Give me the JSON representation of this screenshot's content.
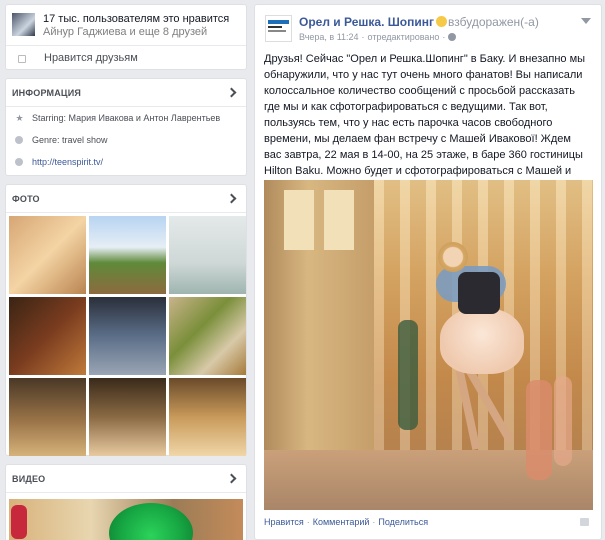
{
  "likes": {
    "count_text": "17 тыс. пользователям это нравится",
    "names_text": "Айнур Гаджиева и еще 8 друзей",
    "friends_button": "Нравится друзьям"
  },
  "info": {
    "title": "ИНФОРМАЦИЯ",
    "starring": "Starring: Мария Ивакова и Антон Лаврентьев",
    "genre": "Genre: travel show",
    "link": "http://teenspirit.tv/"
  },
  "photos": {
    "title": "ФОТО",
    "items": [
      {
        "bg": "linear-gradient(135deg,#d7a675,#f4d4a4 50%,#b98450)"
      },
      {
        "bg": "linear-gradient(180deg,#b7d4f2 0%,#e6eef5 40%,#5f8a3a 60%,#8c6b3e 100%)"
      },
      {
        "bg": "linear-gradient(180deg,#e4e9ea,#cfd8d6 60%,#9fb5b0)"
      },
      {
        "bg": "linear-gradient(135deg,#3a2414,#7a3c1f 50%,#c07a3a)"
      },
      {
        "bg": "linear-gradient(180deg,#2a2f3a,#5b6e88 50%,#9aa5b5)"
      },
      {
        "bg": "linear-gradient(135deg,#c9b38a,#7a8f3a 40%,#d8c9a8 70%,#a57a3a)"
      },
      {
        "bg": "linear-gradient(180deg,#4a3826,#9a7448 55%,#d6b27a)"
      },
      {
        "bg": "linear-gradient(180deg,#3a2a1a,#8a6a44 50%,#e8caa0)"
      },
      {
        "bg": "linear-gradient(180deg,#6a4a2a,#c89a5a 50%,#f0d6a8)"
      }
    ]
  },
  "video": {
    "title": "ВИДЕО"
  },
  "post": {
    "page_name": "Орел и Решка. Шопинг",
    "feeling": "взбудоражен(-а)",
    "time": "Вчера, в 11:24",
    "edited": "отредактировано",
    "text": "Друзья! Сейчас \"Орел и Решка.Шопинг\" в Баку. И внезапно мы обнаружили, что у нас тут очень много фанатов! Вы написали колоссальное количество сообщений с просьбой рассказать где мы и как сфотографироваться с ведущими. Так вот, пользуясь тем, что у нас есть парочка часов свободного времени, мы делаем фан встречу с Машей Ивакової! Ждем вас завтра, 22 мая в 14-00, на 25 этаже, в баре 360 гостиницы Hilton Baku. Можно будет и сфотографироваться с Машей и взять автограф и даже задать интересующие вас вопросы! Ждем вас всех!",
    "actions": {
      "like": "Нравится",
      "comment": "Комментарий",
      "share": "Поделиться"
    }
  }
}
